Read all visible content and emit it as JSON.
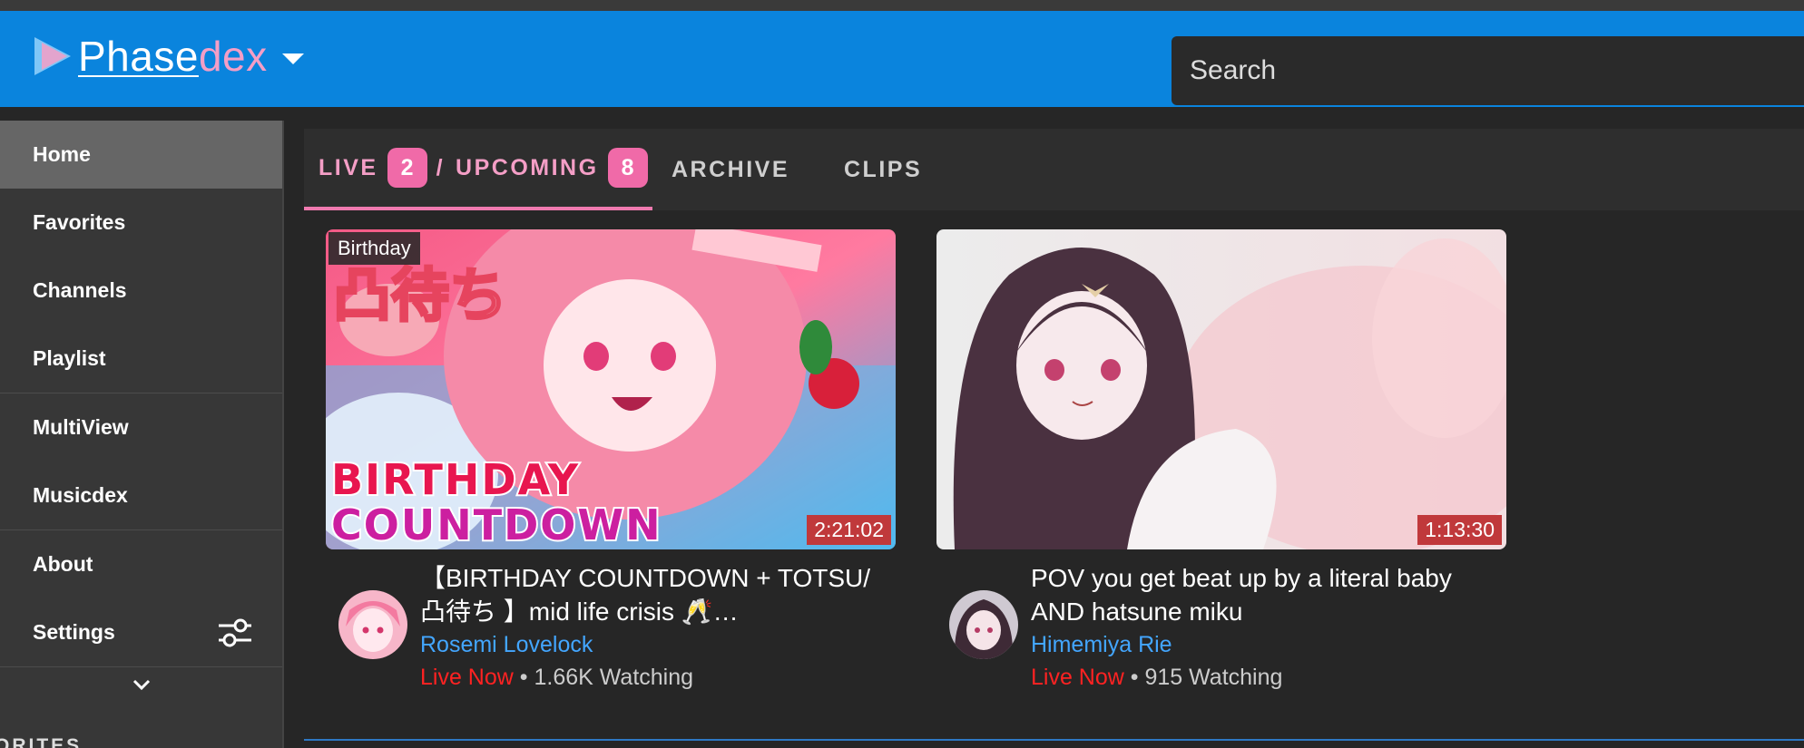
{
  "app": {
    "logo_part1": "Phase",
    "logo_part2": "dex",
    "brand_blue": "#0a84dd",
    "brand_pink": "#f49ec6"
  },
  "search": {
    "placeholder": "Search"
  },
  "sidebar": {
    "items": [
      {
        "label": "Home",
        "active": true
      },
      {
        "label": "Favorites"
      },
      {
        "label": "Channels"
      },
      {
        "label": "Playlist"
      },
      {
        "label": "MultiView"
      },
      {
        "label": "Musicdex"
      },
      {
        "label": "About"
      },
      {
        "label": "Settings",
        "icon": "sliders-icon"
      }
    ],
    "expand_icon": "chevron-down-icon",
    "section_title": "ORITES"
  },
  "tabs": {
    "live_label": "LIVE",
    "live_count": "2",
    "separator": "/",
    "upcoming_label": "UPCOMING",
    "upcoming_count": "8",
    "archive_label": "ARCHIVE",
    "clips_label": "CLIPS"
  },
  "videos": [
    {
      "topic": "Birthday",
      "thumb_text_1": "BIRTHDAY",
      "thumb_text_2": "COUNTDOWN",
      "thumb_text_jp": "凸待ち",
      "duration": "2:21:02",
      "title": "【BIRTHDAY COUNTDOWN + TOTSU/凸待ち 】mid life crisis 🥂…",
      "channel": "Rosemi Lovelock",
      "live_label": "Live Now",
      "viewers": " • 1.66K Watching"
    },
    {
      "duration": "1:13:30",
      "title": "POV you get beat up by a literal baby AND hatsune miku",
      "channel": "Himemiya Rie",
      "live_label": "Live Now",
      "viewers": " • 915 Watching"
    }
  ]
}
